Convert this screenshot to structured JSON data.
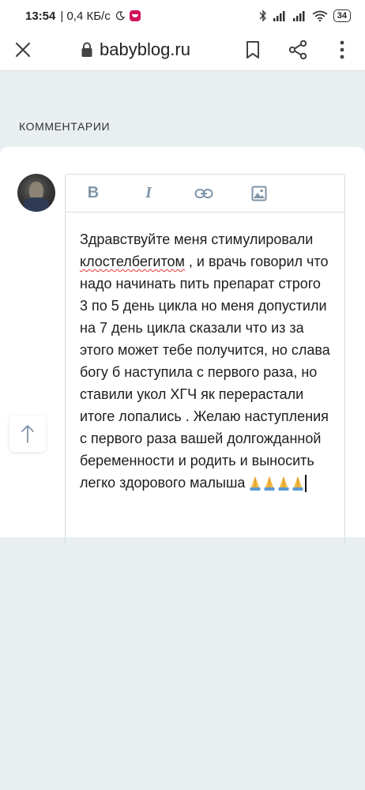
{
  "status_bar": {
    "time": "13:54",
    "speed": "| 0,4 КБ/с",
    "battery": "34"
  },
  "browser": {
    "domain": "babyblog.ru"
  },
  "comments": {
    "section_title": "КОММЕНТАРИИ",
    "editor": {
      "toolbar": {
        "bold": "B",
        "italic": "I"
      },
      "text_before": "Здравствуйте меня стимулировали ",
      "misspelled_word": "клостелбегитом",
      "text_after": " , и врачь говорил что надо начинать пить препарат строго 3 по 5 день цикла но меня допустили на 7 день цикла сказали что из за этого может тебе получится, но слава богу б наступила с первого раза, но ставили укол ХГЧ як перерастали итоге лопались . Желаю наступления с первого раза вашей долгожданной беременности и родить и выносить легко здорового малыша ",
      "emoji_count": 4,
      "icons": [
        "bold-icon",
        "italic-icon",
        "link-icon",
        "image-icon"
      ]
    }
  },
  "colors": {
    "background": "#e9eff1",
    "toolbar_icon": "#7f95a8",
    "spellcheck": "#e53935"
  }
}
